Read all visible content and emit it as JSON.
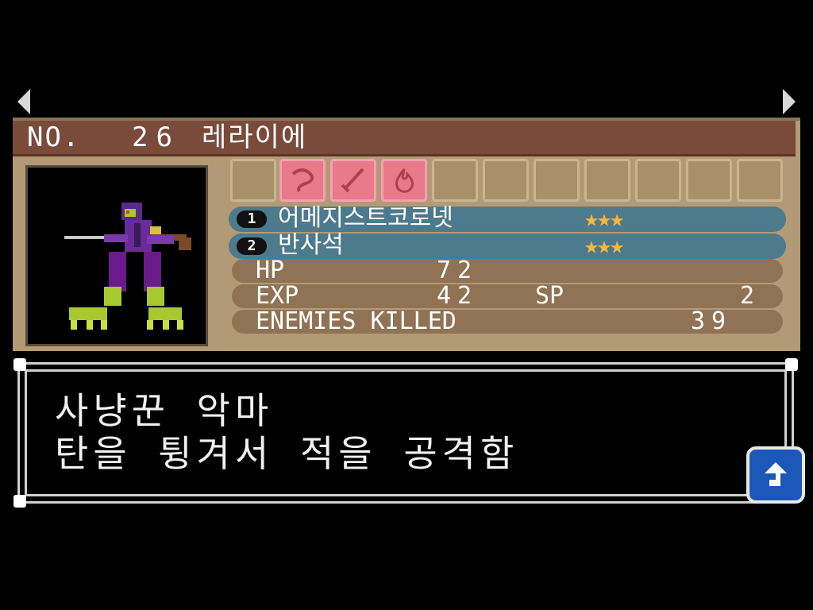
{
  "nav": {
    "prev_icon": "triangle-left-icon",
    "next_icon": "triangle-right-icon"
  },
  "header": {
    "no_label": "NO.",
    "number": "26",
    "name": "레라이에"
  },
  "portrait": {
    "icon": "hunter-demon-portrait"
  },
  "ability_slots": {
    "active": [
      "whip-icon",
      "sword-icon",
      "fire-icon"
    ],
    "total_slots": 11
  },
  "drops": [
    {
      "badge": "1",
      "name": "어메지스트코로넷",
      "stars": "★★★"
    },
    {
      "badge": "2",
      "name": "반사석",
      "stars": "★★★"
    }
  ],
  "stats": {
    "hp_label": "HP",
    "hp_value": "72",
    "exp_label": "EXP",
    "exp_value": "42",
    "sp_label": "SP",
    "sp_value": "2",
    "kills_label": "ENEMIES KILLED",
    "kills_value": "39"
  },
  "description": {
    "line1": "사냥꾼 악마",
    "line2": "탄을 튕겨서 적을 공격함"
  },
  "next_button": {
    "icon": "up-arrow-icon"
  },
  "colors": {
    "panel": "#b39a76",
    "title_bar": "#7a4a3a",
    "item_bar": "#4d7a8c",
    "stat_bar": "#8f7354",
    "active_slot": "#e87a8a",
    "star": "#f5b93a",
    "button": "#1b58b8"
  }
}
